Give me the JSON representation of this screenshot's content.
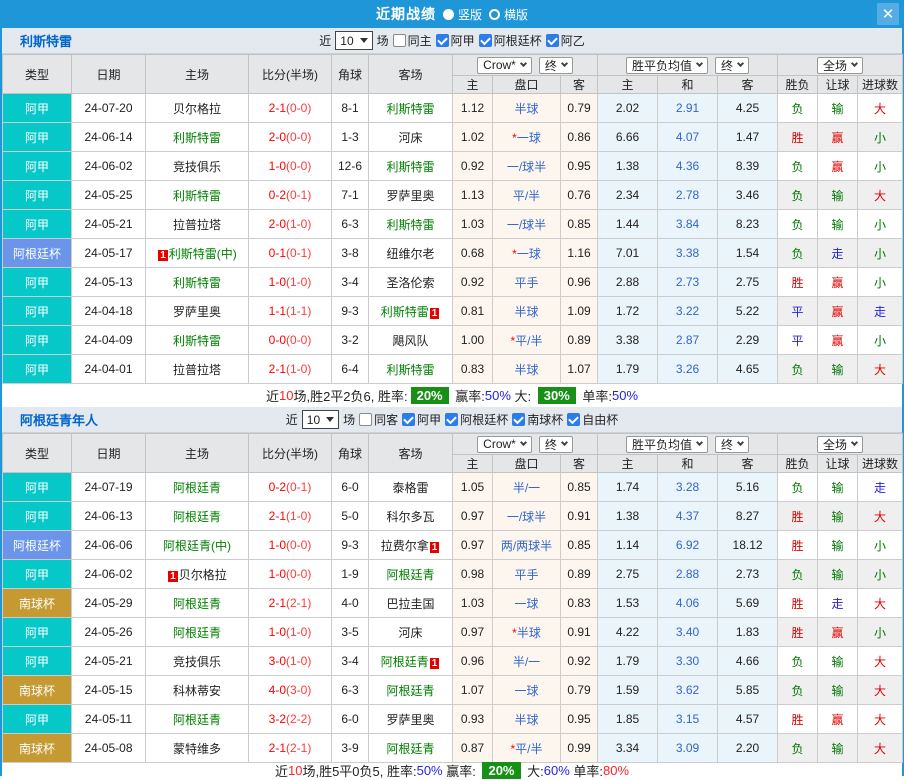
{
  "topbar": {
    "title": "近期战绩",
    "radios": [
      {
        "label": "竖版",
        "selected": true
      },
      {
        "label": "横版",
        "selected": false
      }
    ],
    "close": "✕"
  },
  "colors": {
    "titlebar_blue": "#1e96d8",
    "section_title_blue": "#0066cc",
    "type_colors": {
      "阿甲": "#06c8c8",
      "阿根廷杯": "#6a95ea",
      "南球杯": "#c69a33"
    },
    "team_green": "#008000",
    "score_red": "#ff0000",
    "badge_green": "#169116",
    "result_colors": {
      "胜": "#e10000",
      "平": "#2222dd",
      "负": "#007500",
      "赢": "#e10000",
      "走": "#2222dd",
      "输": "#007500",
      "大": "#e10000",
      "小": "#007500"
    }
  },
  "table_header": {
    "static_cols": [
      "类型",
      "日期",
      "主场",
      "比分(半场)",
      "角球",
      "客场"
    ],
    "odds_group": {
      "dd1": "Crow*",
      "dd2": "终",
      "sub": [
        "主",
        "盘口",
        "客"
      ]
    },
    "avg_group": {
      "dd1": "胜平负均值",
      "dd2": "终",
      "sub": [
        "主",
        "和",
        "客"
      ]
    },
    "result_group": {
      "dd1": "全场",
      "sub": [
        "胜负",
        "让球",
        "进球数"
      ]
    }
  },
  "sections": [
    {
      "team": "利斯特雷",
      "filters": {
        "prefix": "近",
        "select": "10",
        "suffix": "场",
        "same": {
          "label": "同主",
          "checked": false
        },
        "leagues": [
          {
            "label": "阿甲",
            "checked": true
          },
          {
            "label": "阿根廷杯",
            "checked": true
          },
          {
            "label": "阿乙",
            "checked": true
          }
        ]
      },
      "rows": [
        {
          "type": "阿甲",
          "date": "24-07-20",
          "home": {
            "t": "贝尔格拉"
          },
          "score": "2-1",
          "half": "(0-0)",
          "corner": "8-1",
          "away": {
            "t": "利斯特雷",
            "green": true
          },
          "o1": "1.12",
          "pk": "半球",
          "star": false,
          "o2": "0.79",
          "a1": "2.02",
          "a2": "2.91",
          "a3": "4.25",
          "r": [
            "负",
            "输",
            "大"
          ]
        },
        {
          "type": "阿甲",
          "date": "24-06-14",
          "home": {
            "t": "利斯特雷",
            "green": true
          },
          "score": "2-0",
          "half": "(0-0)",
          "corner": "1-3",
          "away": {
            "t": "河床"
          },
          "o1": "1.02",
          "pk": "一球",
          "star": true,
          "o2": "0.86",
          "a1": "6.66",
          "a2": "4.07",
          "a3": "1.47",
          "r": [
            "胜",
            "赢",
            "小"
          ]
        },
        {
          "type": "阿甲",
          "date": "24-06-02",
          "home": {
            "t": "竞技俱乐"
          },
          "score": "1-0",
          "half": "(0-0)",
          "corner": "12-6",
          "away": {
            "t": "利斯特雷",
            "green": true
          },
          "o1": "0.92",
          "pk": "一/球半",
          "star": false,
          "o2": "0.95",
          "a1": "1.38",
          "a2": "4.36",
          "a3": "8.39",
          "r": [
            "负",
            "赢",
            "小"
          ]
        },
        {
          "type": "阿甲",
          "date": "24-05-25",
          "home": {
            "t": "利斯特雷",
            "green": true
          },
          "score": "0-2",
          "half": "(0-1)",
          "corner": "7-1",
          "away": {
            "t": "罗萨里奥"
          },
          "o1": "1.13",
          "pk": "平/半",
          "star": false,
          "o2": "0.76",
          "a1": "2.34",
          "a2": "2.78",
          "a3": "3.46",
          "r": [
            "负",
            "输",
            "大"
          ]
        },
        {
          "type": "阿甲",
          "date": "24-05-21",
          "home": {
            "t": "拉普拉塔"
          },
          "score": "2-0",
          "half": "(1-0)",
          "corner": "6-3",
          "away": {
            "t": "利斯特雷",
            "green": true
          },
          "o1": "1.03",
          "pk": "一/球半",
          "star": false,
          "o2": "0.85",
          "a1": "1.44",
          "a2": "3.84",
          "a3": "8.23",
          "r": [
            "负",
            "输",
            "小"
          ]
        },
        {
          "type": "阿根廷杯",
          "date": "24-05-17",
          "home": {
            "t": "利斯特雷(中)",
            "green": true,
            "card": "before"
          },
          "score": "0-1",
          "half": "(0-1)",
          "corner": "3-8",
          "away": {
            "t": "纽维尔老"
          },
          "o1": "0.68",
          "pk": "一球",
          "star": true,
          "o2": "1.16",
          "a1": "7.01",
          "a2": "3.38",
          "a3": "1.54",
          "r": [
            "负",
            "走",
            "小"
          ]
        },
        {
          "type": "阿甲",
          "date": "24-05-13",
          "home": {
            "t": "利斯特雷",
            "green": true
          },
          "score": "1-0",
          "half": "(1-0)",
          "corner": "3-4",
          "away": {
            "t": "圣洛伦索"
          },
          "o1": "0.92",
          "pk": "平手",
          "star": false,
          "o2": "0.96",
          "a1": "2.88",
          "a2": "2.73",
          "a3": "2.75",
          "r": [
            "胜",
            "赢",
            "小"
          ]
        },
        {
          "type": "阿甲",
          "date": "24-04-18",
          "home": {
            "t": "罗萨里奥"
          },
          "score": "1-1",
          "half": "(1-1)",
          "corner": "9-3",
          "away": {
            "t": "利斯特雷",
            "green": true,
            "card": "after"
          },
          "o1": "0.81",
          "pk": "半球",
          "star": false,
          "o2": "1.09",
          "a1": "1.72",
          "a2": "3.22",
          "a3": "5.22",
          "r": [
            "平",
            "赢",
            "走"
          ]
        },
        {
          "type": "阿甲",
          "date": "24-04-09",
          "home": {
            "t": "利斯特雷",
            "green": true
          },
          "score": "0-0",
          "half": "(0-0)",
          "corner": "3-2",
          "away": {
            "t": "飓风队"
          },
          "o1": "1.00",
          "pk": "平/半",
          "star": true,
          "o2": "0.89",
          "a1": "3.38",
          "a2": "2.87",
          "a3": "2.29",
          "r": [
            "平",
            "赢",
            "小"
          ]
        },
        {
          "type": "阿甲",
          "date": "24-04-01",
          "home": {
            "t": "拉普拉塔"
          },
          "score": "2-1",
          "half": "(1-0)",
          "corner": "6-4",
          "away": {
            "t": "利斯特雷",
            "green": true
          },
          "o1": "0.83",
          "pk": "半球",
          "star": false,
          "o2": "1.07",
          "a1": "1.79",
          "a2": "3.26",
          "a3": "4.65",
          "r": [
            "负",
            "输",
            "大"
          ]
        }
      ],
      "summary": [
        {
          "t": "近"
        },
        {
          "t": "10",
          "c": "red"
        },
        {
          "t": "场,胜2平2负6, 胜率:"
        },
        {
          "t": "20%",
          "b": true
        },
        {
          "t": " 赢率:"
        },
        {
          "t": "50%",
          "c": "blue"
        },
        {
          "t": " 大: "
        },
        {
          "t": "30%",
          "b": true
        },
        {
          "t": " 单率:"
        },
        {
          "t": "50%",
          "c": "blue"
        }
      ]
    },
    {
      "team": "阿根廷青年人",
      "filters": {
        "prefix": "近",
        "select": "10",
        "suffix": "场",
        "same": {
          "label": "同客",
          "checked": false
        },
        "leagues": [
          {
            "label": "阿甲",
            "checked": true
          },
          {
            "label": "阿根廷杯",
            "checked": true
          },
          {
            "label": "南球杯",
            "checked": true
          },
          {
            "label": "自由杯",
            "checked": true
          }
        ]
      },
      "rows": [
        {
          "type": "阿甲",
          "date": "24-07-19",
          "home": {
            "t": "阿根廷青",
            "green": true
          },
          "score": "0-2",
          "half": "(0-1)",
          "corner": "6-0",
          "away": {
            "t": "泰格雷"
          },
          "o1": "1.05",
          "pk": "半/一",
          "star": false,
          "o2": "0.85",
          "a1": "1.74",
          "a2": "3.28",
          "a3": "5.16",
          "r": [
            "负",
            "输",
            "走"
          ]
        },
        {
          "type": "阿甲",
          "date": "24-06-13",
          "home": {
            "t": "阿根廷青",
            "green": true
          },
          "score": "2-1",
          "half": "(1-0)",
          "corner": "5-0",
          "away": {
            "t": "科尔多瓦"
          },
          "o1": "0.97",
          "pk": "一/球半",
          "star": false,
          "o2": "0.91",
          "a1": "1.38",
          "a2": "4.37",
          "a3": "8.27",
          "r": [
            "胜",
            "输",
            "大"
          ]
        },
        {
          "type": "阿根廷杯",
          "date": "24-06-06",
          "home": {
            "t": "阿根廷青(中)",
            "green": true
          },
          "score": "1-0",
          "half": "(0-0)",
          "corner": "9-3",
          "away": {
            "t": "拉费尔拿",
            "card": "after"
          },
          "o1": "0.97",
          "pk": "两/两球半",
          "star": false,
          "o2": "0.85",
          "a1": "1.14",
          "a2": "6.92",
          "a3": "18.12",
          "r": [
            "胜",
            "输",
            "小"
          ]
        },
        {
          "type": "阿甲",
          "date": "24-06-02",
          "home": {
            "t": "贝尔格拉",
            "card": "before"
          },
          "score": "1-0",
          "half": "(0-0)",
          "corner": "1-9",
          "away": {
            "t": "阿根廷青",
            "green": true
          },
          "o1": "0.98",
          "pk": "平手",
          "star": false,
          "o2": "0.89",
          "a1": "2.75",
          "a2": "2.88",
          "a3": "2.73",
          "r": [
            "负",
            "输",
            "小"
          ]
        },
        {
          "type": "南球杯",
          "date": "24-05-29",
          "home": {
            "t": "阿根廷青",
            "green": true
          },
          "score": "2-1",
          "half": "(2-1)",
          "corner": "4-0",
          "away": {
            "t": "巴拉圭国"
          },
          "o1": "1.03",
          "pk": "一球",
          "star": false,
          "o2": "0.83",
          "a1": "1.53",
          "a2": "4.06",
          "a3": "5.69",
          "r": [
            "胜",
            "走",
            "大"
          ]
        },
        {
          "type": "阿甲",
          "date": "24-05-26",
          "home": {
            "t": "阿根廷青",
            "green": true
          },
          "score": "1-0",
          "half": "(1-0)",
          "corner": "3-5",
          "away": {
            "t": "河床"
          },
          "o1": "0.97",
          "pk": "半球",
          "star": true,
          "o2": "0.91",
          "a1": "4.22",
          "a2": "3.40",
          "a3": "1.83",
          "r": [
            "胜",
            "赢",
            "小"
          ]
        },
        {
          "type": "阿甲",
          "date": "24-05-21",
          "home": {
            "t": "竞技俱乐"
          },
          "score": "3-0",
          "half": "(1-0)",
          "corner": "3-4",
          "away": {
            "t": "阿根廷青",
            "green": true,
            "card": "after"
          },
          "o1": "0.96",
          "pk": "半/一",
          "star": false,
          "o2": "0.92",
          "a1": "1.79",
          "a2": "3.30",
          "a3": "4.66",
          "r": [
            "负",
            "输",
            "大"
          ]
        },
        {
          "type": "南球杯",
          "date": "24-05-15",
          "home": {
            "t": "科林蒂安"
          },
          "score": "4-0",
          "half": "(3-0)",
          "corner": "6-3",
          "away": {
            "t": "阿根廷青",
            "green": true
          },
          "o1": "1.07",
          "pk": "一球",
          "star": false,
          "o2": "0.79",
          "a1": "1.59",
          "a2": "3.62",
          "a3": "5.85",
          "r": [
            "负",
            "输",
            "大"
          ]
        },
        {
          "type": "阿甲",
          "date": "24-05-11",
          "home": {
            "t": "阿根廷青",
            "green": true
          },
          "score": "3-2",
          "half": "(2-2)",
          "corner": "6-0",
          "away": {
            "t": "罗萨里奥"
          },
          "o1": "0.93",
          "pk": "半球",
          "star": false,
          "o2": "0.95",
          "a1": "1.85",
          "a2": "3.15",
          "a3": "4.57",
          "r": [
            "胜",
            "赢",
            "大"
          ]
        },
        {
          "type": "南球杯",
          "date": "24-05-08",
          "home": {
            "t": "蒙特维多"
          },
          "score": "2-1",
          "half": "(2-1)",
          "corner": "3-9",
          "away": {
            "t": "阿根廷青",
            "green": true
          },
          "o1": "0.87",
          "pk": "平/半",
          "star": true,
          "o2": "0.99",
          "a1": "3.34",
          "a2": "3.09",
          "a3": "2.20",
          "r": [
            "负",
            "输",
            "大"
          ]
        }
      ],
      "summary": [
        {
          "t": "近"
        },
        {
          "t": "10",
          "c": "red"
        },
        {
          "t": "场,胜5平0负5, 胜率:"
        },
        {
          "t": "50%",
          "c": "blue"
        },
        {
          "t": " 赢率: "
        },
        {
          "t": "20%",
          "b": true
        },
        {
          "t": " 大:"
        },
        {
          "t": "60%",
          "c": "blue"
        },
        {
          "t": " 单率:"
        },
        {
          "t": "80%",
          "c": "red"
        }
      ]
    }
  ]
}
